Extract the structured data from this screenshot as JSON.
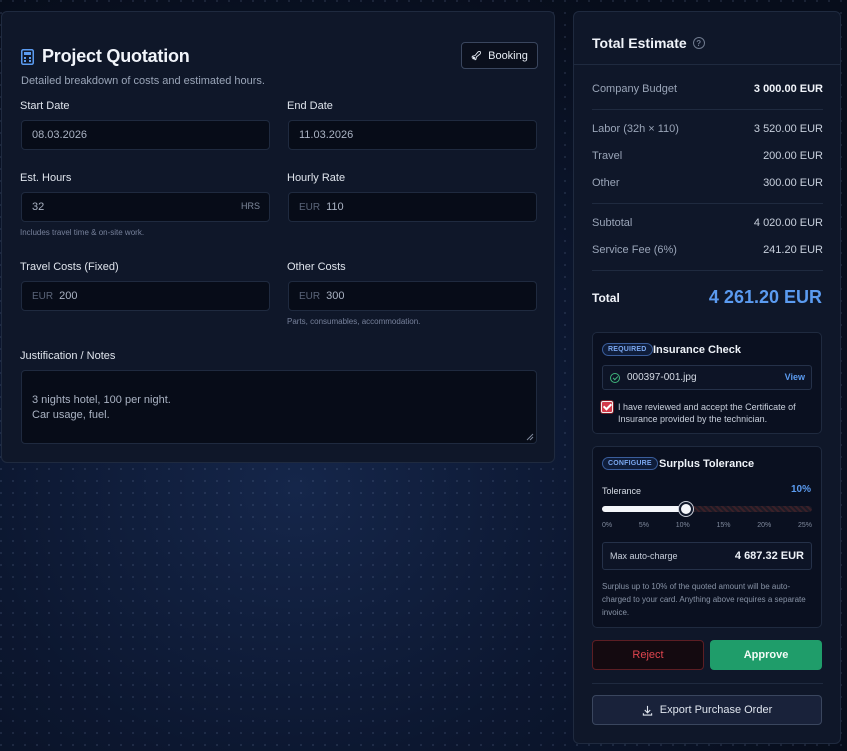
{
  "quotation": {
    "title": "Project Quotation",
    "subtitle": "Detailed breakdown of costs and estimated hours.",
    "booking_label": "Booking",
    "start_date": {
      "label": "Start Date",
      "value": "08.03.2026"
    },
    "end_date": {
      "label": "End Date",
      "value": "11.03.2026"
    },
    "est_hours": {
      "label": "Est. Hours",
      "value": "32",
      "suffix": "HRS",
      "hint": "Includes travel time & on-site work."
    },
    "hourly_rate": {
      "label": "Hourly Rate",
      "prefix": "EUR",
      "value": "110"
    },
    "travel_costs": {
      "label": "Travel Costs (Fixed)",
      "prefix": "EUR",
      "value": "200"
    },
    "other_costs": {
      "label": "Other Costs",
      "prefix": "EUR",
      "value": "300",
      "hint": "Parts, consumables, accommodation."
    },
    "notes": {
      "label": "Justification / Notes",
      "value": "3 nights hotel, 100 per night.\nCar usage, fuel."
    }
  },
  "estimate": {
    "title": "Total Estimate",
    "rows": {
      "budget": {
        "label": "Company Budget",
        "value": "3 000.00 EUR"
      },
      "labor": {
        "label": "Labor (32h × 110)",
        "value": "3 520.00 EUR"
      },
      "travel": {
        "label": "Travel",
        "value": "200.00 EUR"
      },
      "other": {
        "label": "Other",
        "value": "300.00 EUR"
      },
      "subtotal": {
        "label": "Subtotal",
        "value": "4 020.00 EUR"
      },
      "fee": {
        "label": "Service Fee (6%)",
        "value": "241.20 EUR"
      }
    },
    "total": {
      "label": "Total",
      "value": "4 261.20 EUR"
    },
    "insurance": {
      "badge": "REQUIRED",
      "title": "Insurance Check",
      "file_name": "000397-001.jpg",
      "view_label": "View",
      "checked": true,
      "consent_text": "I have reviewed and accept the Certificate of Insurance provided by the technician."
    },
    "surplus": {
      "badge": "CONFIGURE",
      "title": "Surplus Tolerance",
      "tolerance_label": "Tolerance",
      "tolerance_value": "10%",
      "tolerance_fraction": 0.4,
      "ticks": [
        "0%",
        "5%",
        "10%",
        "15%",
        "20%",
        "25%"
      ],
      "max_label": "Max auto-charge",
      "max_value": "4 687.32 EUR",
      "note": "Surplus up to 10% of the quoted amount will be auto-charged to your card. Anything above requires a separate invoice."
    },
    "reject_label": "Reject",
    "approve_label": "Approve",
    "export_label": "Export Purchase Order"
  },
  "colors": {
    "accent": "#5b9bf0",
    "approve": "#1f9d6a",
    "reject": "#e0454f"
  }
}
